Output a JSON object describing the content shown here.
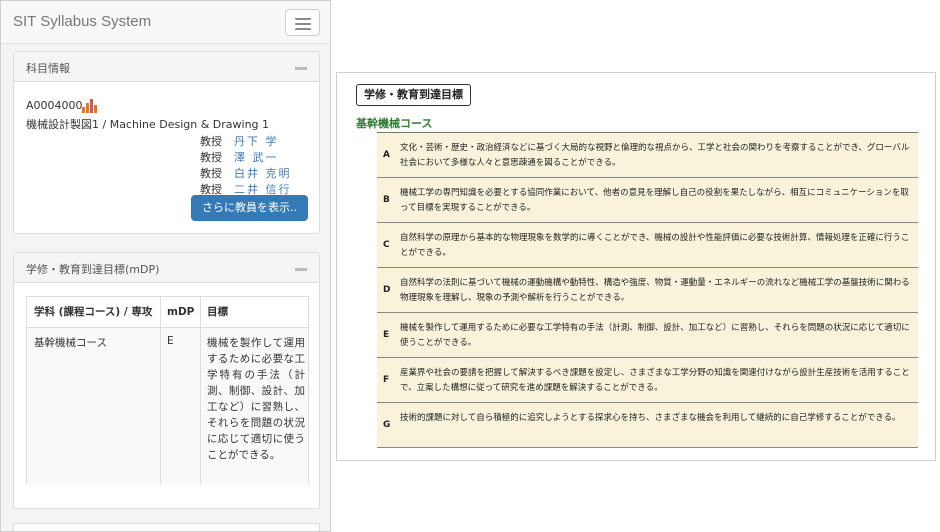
{
  "app": {
    "brand": "SIT Syllabus System"
  },
  "course_panel": {
    "title": "科目情報",
    "code": "A0004000",
    "name": "機械設計製図1 / Machine Design & Drawing 1",
    "instructors": [
      {
        "rank": "教授",
        "name": "丹下 学"
      },
      {
        "rank": "教授",
        "name": "澤 武一"
      },
      {
        "rank": "教授",
        "name": "白井 克明"
      },
      {
        "rank": "教授",
        "name": "二井 信行"
      }
    ],
    "more_button": "さらに教員を表示.."
  },
  "goals_panel": {
    "title": "学修・教育到達目標(mDP)",
    "headers": [
      "学科 (課程コース) / 専攻",
      "mDP",
      "目標"
    ],
    "row": {
      "course": "基幹機械コース",
      "mdp": "E",
      "goal": "機械を製作して運用するために必要な工学特有の手法（計測、制御、設計、加工など）に習熟し、それらを問題の状況に応じて適切に使うことができる。"
    }
  },
  "document": {
    "title": "学修・教育到達目標",
    "subtitle": "基幹機械コース",
    "goals": [
      {
        "letter": "A",
        "text": "文化・芸術・歴史・政治経済などに基づく大局的な視野と倫理的な視点から、工学と社会の関わりを考察することができ、グローバル社会において多様な人々と意思疎通を図ることができる。"
      },
      {
        "letter": "B",
        "text": "機械工学の専門知識を必要とする協同作業において、他者の意見を理解し自己の役割を果たしながら、相互にコミュニケーションを取って目標を実現することができる。"
      },
      {
        "letter": "C",
        "text": "自然科学の原理から基本的な物理現象を数学的に導くことができ、機械の設計や性能評価に必要な技術計算、情報処理を正確に行うことができる。"
      },
      {
        "letter": "D",
        "text": "自然科学の法則に基づいて機械の運動機構や動特性、構造や強度、物質・運動量・エネルギーの流れなど機械工学の基盤技術に関わる物理現象を理解し、現象の予測や解析を行うことができる。"
      },
      {
        "letter": "E",
        "text": "機械を製作して運用するために必要な工学特有の手法（計測、制御、設計、加工など）に習熟し、それらを問題の状況に応じて適切に使うことができる。"
      },
      {
        "letter": "F",
        "text": "産業界や社会の要請を把握して解決するべき課題を設定し、さまざまな工学分野の知識を関連付けながら設計生産技術を活用することで、立案した構想に従って研究を進め課題を解決することができる。"
      },
      {
        "letter": "G",
        "text": "技術的課題に対して自ら積極的に追究しようとする探求心を持ち、さまざまな機会を利用して継続的に自己学修することができる。"
      }
    ]
  },
  "colors": {
    "link": "#3c7fbc",
    "primary_button": "#337ab7",
    "subtitle_green": "#2e7d32",
    "goal_row_bg": "#faf3dc",
    "chart_icon_orange": "#e8731a"
  }
}
